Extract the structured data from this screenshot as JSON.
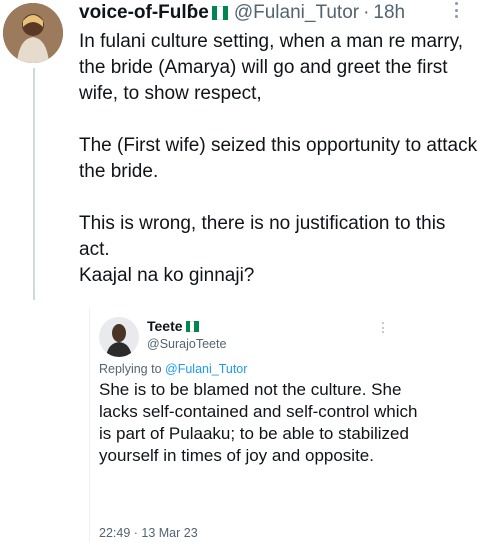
{
  "tweet": {
    "display_name": "voice-of-Fulɓe",
    "handle": "@Fulani_Tutor",
    "separator": "·",
    "time": "18h",
    "paragraphs": [
      "In fulani culture setting, when a man re marry, the bride (Amarya) will go and greet the first wife, to show respect,",
      "The (First wife) seized this opportunity to attack the bride.",
      "This is wrong, there is no justification to this act.",
      "Kaajal na ko ginnaji?"
    ]
  },
  "quoted": {
    "display_name": "Teete",
    "handle": "@SurajoTeete",
    "replying_prefix": "Replying to ",
    "replying_to": "@Fulani_Tutor",
    "text": "She is to be blamed not the culture. She lacks self-contained and self-control which is part of Pulaaku; to be able to stabilized yourself in times of joy and opposite.",
    "timestamp": "22:49 · 13 Mar 23"
  },
  "icons": {
    "more": "more-vertical-icon",
    "flag": "nigeria-flag-icon"
  },
  "colors": {
    "flag_green": "#008751",
    "flag_white": "#ffffff",
    "link": "#1d9bf0",
    "muted": "#536471"
  }
}
